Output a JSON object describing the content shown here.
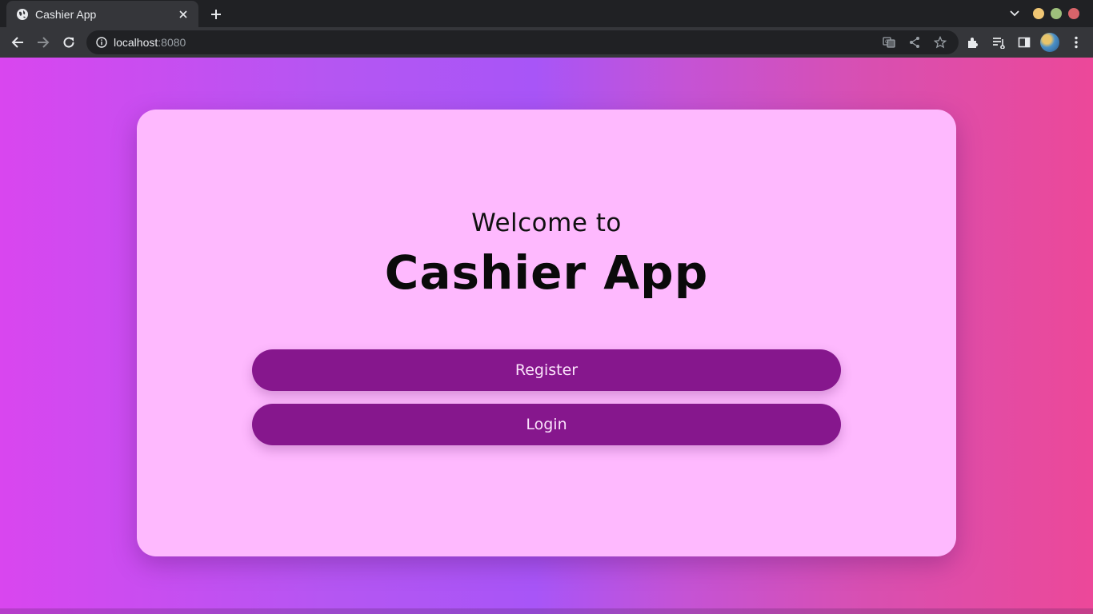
{
  "browser": {
    "tab_title": "Cashier App",
    "url_host": "localhost",
    "url_port": ":8080"
  },
  "colors": {
    "accent_button": "#86178d",
    "card_background": "#feb9fe",
    "gradient_left": "#d946ef",
    "gradient_mid": "#a855f7",
    "gradient_right": "#ec4899"
  },
  "icons": [
    "globe-icon",
    "close-icon",
    "plus-icon",
    "chevron-down-icon",
    "back-arrow-icon",
    "forward-arrow-icon",
    "reload-icon",
    "info-icon",
    "translate-icon",
    "share-icon",
    "star-icon",
    "extensions-icon",
    "reading-list-icon",
    "side-panel-icon",
    "kebab-menu-icon"
  ],
  "page": {
    "welcome": "Welcome to",
    "title": "Cashier App",
    "register_label": "Register",
    "login_label": "Login"
  }
}
